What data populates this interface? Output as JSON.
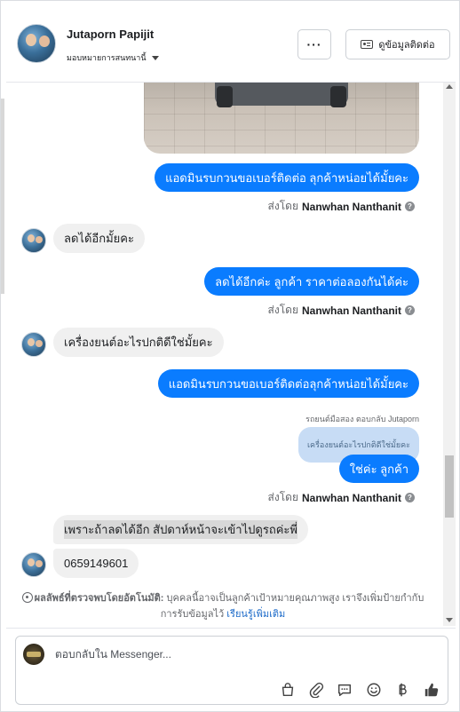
{
  "header": {
    "contact_name": "Jutaporn Papijit",
    "status": "มอบหมายการสนทนานี้",
    "more_label": "···",
    "contact_info_label": "ดูข้อมูลติดต่อ"
  },
  "messages": [
    {
      "id": "m1",
      "dir": "out",
      "text": "แอดมินรบกวนขอเบอร์ติดต่อ ลุกค้าหน่อยได้มั้ยคะ"
    },
    {
      "id": "s1",
      "sent_prefix": "ส่งโดย",
      "sent_name": "Nanwhan Nanthanit"
    },
    {
      "id": "m2",
      "dir": "in",
      "text": "ลดได้อีกมั้ยคะ"
    },
    {
      "id": "m3",
      "dir": "out",
      "text": "ลดได้อีกค่ะ ลูกค้า ราคาต่อลองกันได้ค่ะ"
    },
    {
      "id": "s2",
      "sent_prefix": "ส่งโดย",
      "sent_name": "Nanwhan Nanthanit"
    },
    {
      "id": "m4",
      "dir": "in",
      "text": "เครื่องยนต์อะไรปกติดีใช่มั้ยคะ"
    },
    {
      "id": "m5",
      "dir": "out",
      "text": "แอดมินรบกวนขอเบอร์ติดต่อลุกค้าหน่อยได้มั้ยคะ"
    },
    {
      "id": "m6",
      "reply_note": "รถยนต์มือสอง ตอบกลับ Jutaporn",
      "quoted": "เครื่องยนต์อะไรปกติดีใช่มั้ยคะ",
      "dir": "out",
      "text": "ใช่ค่ะ ลูกค้า"
    },
    {
      "id": "s3",
      "sent_prefix": "ส่งโดย",
      "sent_name": "Nanwhan Nanthanit"
    },
    {
      "id": "m7",
      "dir": "in",
      "text": "เพราะถ้าลดได้อีก สัปดาห์หน้าจะเข้าไปดูรถค่ะพี่"
    },
    {
      "id": "m8",
      "dir": "in",
      "text": "0659149601"
    }
  ],
  "auto_detect": {
    "title": "ผลลัพธ์ที่ตรวจพบโดยอัตโนมัติ:",
    "body": " บุคคลนี้อาจเป็นลูกค้าเป้าหมายคุณภาพสูง เราจึงเพิ่มป้ายกำกับการรับข้อมูลไว้ ",
    "link": "เรียนรู้เพิ่มเติม"
  },
  "composer": {
    "placeholder": "ตอบกลับใน Messenger..."
  },
  "colors": {
    "outgoing_bubble": "#0a7cff",
    "incoming_bubble": "#f0f0f0",
    "link": "#1d6bc9"
  },
  "icons": [
    "shopping-bag-icon",
    "paperclip-icon",
    "saved-reply-icon",
    "emoji-icon",
    "baht-icon",
    "thumbs-up-icon"
  ]
}
